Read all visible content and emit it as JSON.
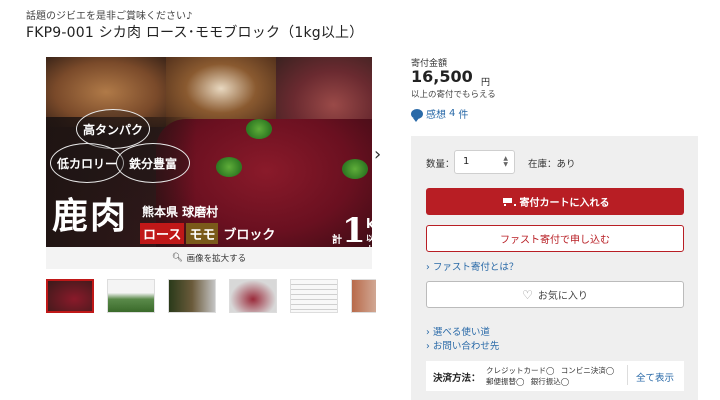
{
  "header": {
    "tagline": "話題のジビエを是非ご賞味ください♪",
    "title": "FKP9-001 シカ肉 ロース･モモブロック（1kg以上）"
  },
  "gallery": {
    "hero_badges": [
      "高タンパク",
      "低カロリー",
      "鉄分豊富"
    ],
    "hero_kanji": "鹿肉",
    "hero_origin": "熊本県 球磨村",
    "hero_cuts": [
      "ロース",
      "モモ",
      "ブロック"
    ],
    "hero_weight": {
      "prefix": "計",
      "number": "1",
      "unit": "kg",
      "suffix": "以上"
    },
    "next_arrow": "›",
    "zoom_label": "画像を拡大する",
    "thumbnails": 6,
    "active_thumbnail": 1
  },
  "pricing": {
    "label": "寄付金額",
    "amount": "16,500",
    "unit": "円",
    "note": "以上の寄付でもらえる",
    "thanks_label": "感想",
    "thanks_count": "4",
    "thanks_suffix": "件"
  },
  "purchase": {
    "qty_label": "数量：",
    "qty_value": "1",
    "stock_text": "在庫：あり",
    "cart_button": "寄付カートに入れる",
    "fast_button": "ファスト寄付で申し込む",
    "fast_link": "ファスト寄付とは？",
    "fav_button": "お気に入り",
    "usage_link": "選べる使い道",
    "contact_link": "お問い合わせ先"
  },
  "payment": {
    "label": "決済方法：",
    "methods": [
      "クレジットカード◯",
      "コンビニ決済◯",
      "郵便振替◯",
      "銀行振込◯"
    ],
    "show_all": "全て表示"
  },
  "colors": {
    "accent_red": "#b81e24",
    "link_blue": "#2a6aa8",
    "panel_gray": "#efefef"
  }
}
